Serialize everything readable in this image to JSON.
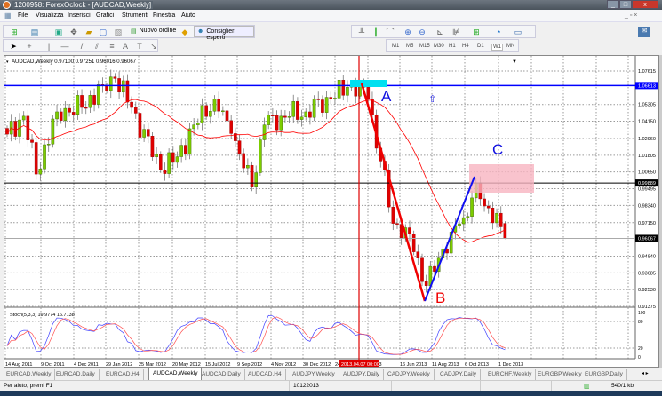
{
  "window": {
    "title": "1200958: ForexOclock - [AUDCAD,Weekly]"
  },
  "menu": [
    "File",
    "Visualizza",
    "Inserisci",
    "Grafici",
    "Strumenti",
    "Finestra",
    "Aiuto"
  ],
  "toolbar": {
    "new_order": "Nuovo ordine",
    "expert_advisors": "Consiglieri esperti"
  },
  "timeframes": [
    "M1",
    "M5",
    "M15",
    "M30",
    "H1",
    "H4",
    "D1",
    "W1",
    "MN"
  ],
  "active_timeframe": "W1",
  "chart": {
    "header": "AUDCAD,Weekly  0.97100 0.97251 0.96016 0.96067",
    "price_labels": [
      "1.07615",
      "1.05305",
      "1.04150",
      "1.02960",
      "1.01805",
      "1.00650",
      "0.99495",
      "0.98340",
      "0.97150",
      "0.94840",
      "0.93685",
      "0.92530",
      "0.91375"
    ],
    "price_values": [
      1.07615,
      1.05305,
      1.0415,
      1.0296,
      1.01805,
      1.0065,
      0.99495,
      0.9834,
      0.9715,
      0.9484,
      0.93685,
      0.9253,
      0.91375
    ],
    "blue_line_label": "1.06613",
    "blue_line_value": 1.06613,
    "black_line_label": "0.99889",
    "black_line_value": 0.99889,
    "bid_label": "0.96067",
    "bid_value": 0.96067,
    "annotations": {
      "a": "A",
      "b": "B",
      "c": "C"
    },
    "stoch_label": "Stoch(5,3,3) 19.9774 16.7138",
    "stoch_levels": [
      "100",
      "80",
      "20",
      "0"
    ],
    "time_labels": [
      "14 Aug 2011",
      "9 Oct 2011",
      "4 Dec 2011",
      "29 Jan 2012",
      "25 Mar 2012",
      "20 May 2012",
      "15 Jul 2012",
      "9 Sep 2012",
      "4 Nov 2012",
      "30 Dec 2012",
      "24",
      "r 2013",
      "16 Jun 2013",
      "11 Aug 2013",
      "6 Oct 2013",
      "1 Dec 2013"
    ],
    "cursor_time": "2013.04.07 00:00",
    "colors": {
      "bull": "#7ccd00",
      "bear": "#e00000",
      "ma": "#ff0000",
      "stoch_main": "#4040ff",
      "stoch_signal": "#ff5050",
      "pattern_a": "#0000ff"
    }
  },
  "chart_data": {
    "type": "candlestick",
    "symbol": "AUDCAD",
    "timeframe": "Weekly",
    "anchor_weeks": [
      0,
      4,
      7,
      12,
      18,
      23,
      26,
      30,
      37,
      41,
      45,
      50,
      54,
      59,
      62,
      66,
      72,
      78,
      82,
      85,
      87,
      90,
      93,
      96,
      99,
      101,
      104,
      107,
      110,
      113,
      115,
      118,
      120
    ],
    "anchor_closes": [
      1.0326,
      1.045,
      1.005,
      1.048,
      1.051,
      1.066,
      1.071,
      1.051,
      1.008,
      1.017,
      1.039,
      1.057,
      1.033,
      0.996,
      1.039,
      1.045,
      1.048,
      1.057,
      1.065,
      1.066,
      1.057,
      1.014,
      0.971,
      0.968,
      0.947,
      0.928,
      0.947,
      0.965,
      0.975,
      0.999,
      0.983,
      0.978,
      0.96067
    ],
    "last_candle": {
      "open": 0.971,
      "high": 0.97251,
      "low": 0.96016,
      "close": 0.96067
    },
    "ma_period": 20,
    "stoch_params": [
      5,
      3,
      3
    ]
  },
  "tabs": [
    "EURCAD,Weekly",
    "EURCAD,Daily",
    "EURCAD,H4",
    "AUDCAD,Weekly",
    "AUDCAD,Daily",
    "AUDCAD,H4",
    "AUDJPY,Weekly",
    "AUDJPY,Daily",
    "CADJPY,Weekly",
    "CADJPY,Daily",
    "EURCHF,Weekly",
    "EURGBP,Weekly",
    "EURGBP,Daily"
  ],
  "active_tab": "AUDCAD,Weekly",
  "status": {
    "help": "Per aiuto, premi F1",
    "date": "10122013",
    "traffic": "540/1 kb"
  }
}
